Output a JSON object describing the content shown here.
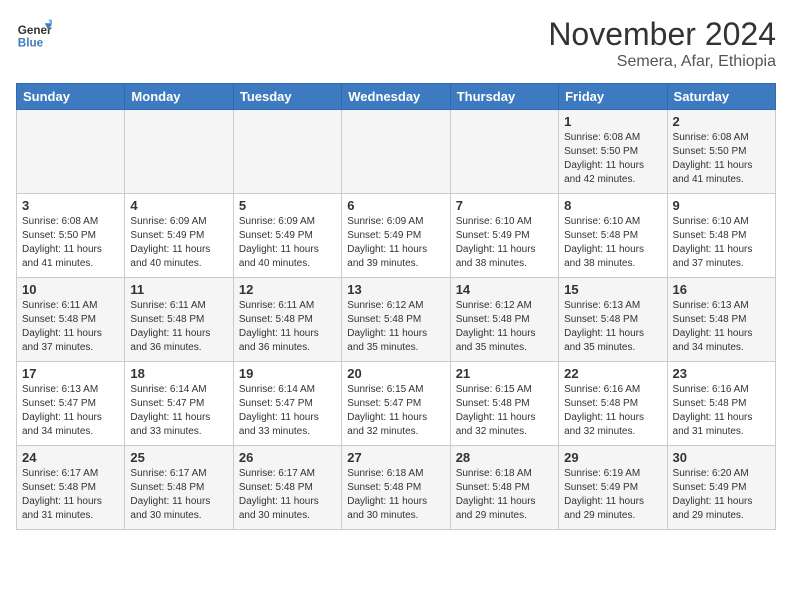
{
  "header": {
    "logo_line1": "General",
    "logo_line2": "Blue",
    "month": "November 2024",
    "location": "Semera, Afar, Ethiopia"
  },
  "weekdays": [
    "Sunday",
    "Monday",
    "Tuesday",
    "Wednesday",
    "Thursday",
    "Friday",
    "Saturday"
  ],
  "weeks": [
    [
      {
        "day": "",
        "info": ""
      },
      {
        "day": "",
        "info": ""
      },
      {
        "day": "",
        "info": ""
      },
      {
        "day": "",
        "info": ""
      },
      {
        "day": "",
        "info": ""
      },
      {
        "day": "1",
        "info": "Sunrise: 6:08 AM\nSunset: 5:50 PM\nDaylight: 11 hours and 42 minutes."
      },
      {
        "day": "2",
        "info": "Sunrise: 6:08 AM\nSunset: 5:50 PM\nDaylight: 11 hours and 41 minutes."
      }
    ],
    [
      {
        "day": "3",
        "info": "Sunrise: 6:08 AM\nSunset: 5:50 PM\nDaylight: 11 hours and 41 minutes."
      },
      {
        "day": "4",
        "info": "Sunrise: 6:09 AM\nSunset: 5:49 PM\nDaylight: 11 hours and 40 minutes."
      },
      {
        "day": "5",
        "info": "Sunrise: 6:09 AM\nSunset: 5:49 PM\nDaylight: 11 hours and 40 minutes."
      },
      {
        "day": "6",
        "info": "Sunrise: 6:09 AM\nSunset: 5:49 PM\nDaylight: 11 hours and 39 minutes."
      },
      {
        "day": "7",
        "info": "Sunrise: 6:10 AM\nSunset: 5:49 PM\nDaylight: 11 hours and 38 minutes."
      },
      {
        "day": "8",
        "info": "Sunrise: 6:10 AM\nSunset: 5:48 PM\nDaylight: 11 hours and 38 minutes."
      },
      {
        "day": "9",
        "info": "Sunrise: 6:10 AM\nSunset: 5:48 PM\nDaylight: 11 hours and 37 minutes."
      }
    ],
    [
      {
        "day": "10",
        "info": "Sunrise: 6:11 AM\nSunset: 5:48 PM\nDaylight: 11 hours and 37 minutes."
      },
      {
        "day": "11",
        "info": "Sunrise: 6:11 AM\nSunset: 5:48 PM\nDaylight: 11 hours and 36 minutes."
      },
      {
        "day": "12",
        "info": "Sunrise: 6:11 AM\nSunset: 5:48 PM\nDaylight: 11 hours and 36 minutes."
      },
      {
        "day": "13",
        "info": "Sunrise: 6:12 AM\nSunset: 5:48 PM\nDaylight: 11 hours and 35 minutes."
      },
      {
        "day": "14",
        "info": "Sunrise: 6:12 AM\nSunset: 5:48 PM\nDaylight: 11 hours and 35 minutes."
      },
      {
        "day": "15",
        "info": "Sunrise: 6:13 AM\nSunset: 5:48 PM\nDaylight: 11 hours and 35 minutes."
      },
      {
        "day": "16",
        "info": "Sunrise: 6:13 AM\nSunset: 5:48 PM\nDaylight: 11 hours and 34 minutes."
      }
    ],
    [
      {
        "day": "17",
        "info": "Sunrise: 6:13 AM\nSunset: 5:47 PM\nDaylight: 11 hours and 34 minutes."
      },
      {
        "day": "18",
        "info": "Sunrise: 6:14 AM\nSunset: 5:47 PM\nDaylight: 11 hours and 33 minutes."
      },
      {
        "day": "19",
        "info": "Sunrise: 6:14 AM\nSunset: 5:47 PM\nDaylight: 11 hours and 33 minutes."
      },
      {
        "day": "20",
        "info": "Sunrise: 6:15 AM\nSunset: 5:47 PM\nDaylight: 11 hours and 32 minutes."
      },
      {
        "day": "21",
        "info": "Sunrise: 6:15 AM\nSunset: 5:48 PM\nDaylight: 11 hours and 32 minutes."
      },
      {
        "day": "22",
        "info": "Sunrise: 6:16 AM\nSunset: 5:48 PM\nDaylight: 11 hours and 32 minutes."
      },
      {
        "day": "23",
        "info": "Sunrise: 6:16 AM\nSunset: 5:48 PM\nDaylight: 11 hours and 31 minutes."
      }
    ],
    [
      {
        "day": "24",
        "info": "Sunrise: 6:17 AM\nSunset: 5:48 PM\nDaylight: 11 hours and 31 minutes."
      },
      {
        "day": "25",
        "info": "Sunrise: 6:17 AM\nSunset: 5:48 PM\nDaylight: 11 hours and 30 minutes."
      },
      {
        "day": "26",
        "info": "Sunrise: 6:17 AM\nSunset: 5:48 PM\nDaylight: 11 hours and 30 minutes."
      },
      {
        "day": "27",
        "info": "Sunrise: 6:18 AM\nSunset: 5:48 PM\nDaylight: 11 hours and 30 minutes."
      },
      {
        "day": "28",
        "info": "Sunrise: 6:18 AM\nSunset: 5:48 PM\nDaylight: 11 hours and 29 minutes."
      },
      {
        "day": "29",
        "info": "Sunrise: 6:19 AM\nSunset: 5:49 PM\nDaylight: 11 hours and 29 minutes."
      },
      {
        "day": "30",
        "info": "Sunrise: 6:20 AM\nSunset: 5:49 PM\nDaylight: 11 hours and 29 minutes."
      }
    ]
  ]
}
